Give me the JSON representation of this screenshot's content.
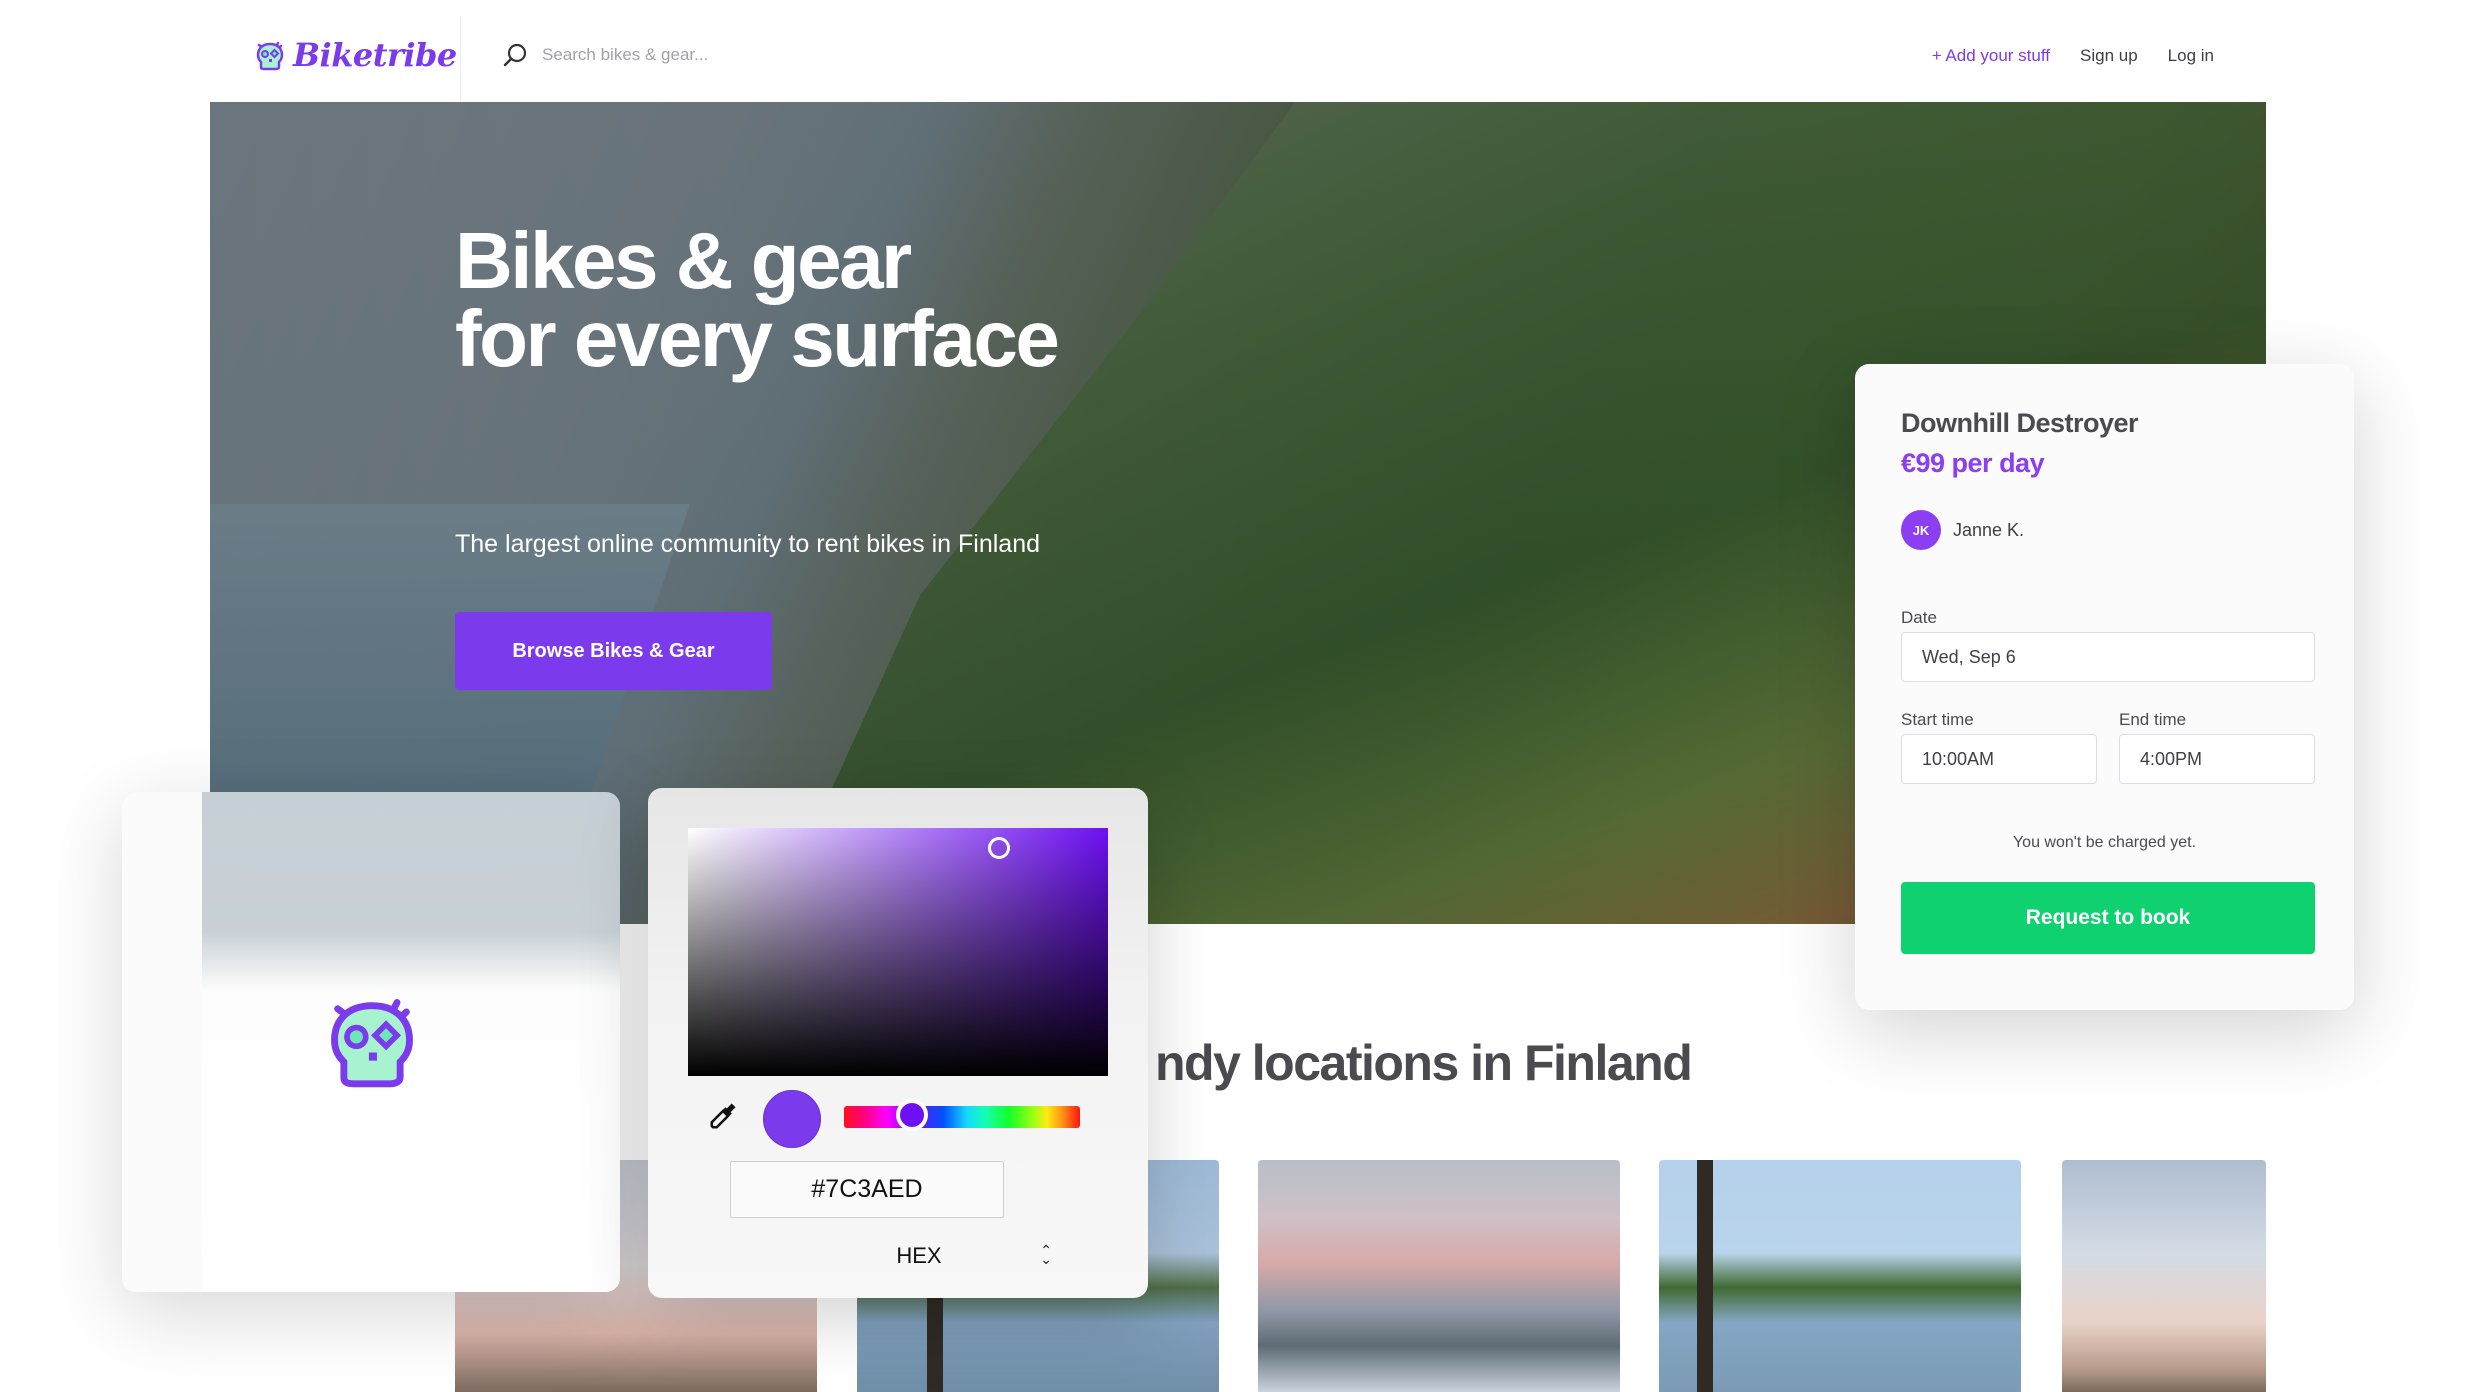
{
  "nav": {
    "brand": "Biketribe",
    "search_placeholder": "Search bikes & gear...",
    "links": [
      {
        "label": "+ Add your stuff",
        "accent": true
      },
      {
        "label": "Sign up",
        "accent": false
      },
      {
        "label": "Log in",
        "accent": false
      }
    ]
  },
  "hero": {
    "title_line1": "Bikes & gear",
    "title_line2": "for every surface",
    "subtitle": "The largest online community to rent bikes in Finland",
    "cta_label": "Browse Bikes & Gear"
  },
  "locations": {
    "title_visible": "ndy locations in Finland",
    "images": [
      "helsinki-cathedral-tram",
      "lake-pines",
      "sunset-lake-valley",
      "lake-tall-pines",
      "helsinki-cathedral-wires"
    ]
  },
  "color_picker": {
    "value": "#7C3AED",
    "format": "HEX",
    "eyedropper_icon": "eyedropper-icon",
    "swatch_color": "#7C3AED",
    "hue_color": "#6D10F2"
  },
  "booking": {
    "title": "Downhill Destroyer",
    "price": "€99 per day",
    "host_initials": "JK",
    "host_name": "Janne K.",
    "date_label": "Date",
    "date_value": "Wed, Sep 6",
    "start_label": "Start time",
    "start_value": "10:00AM",
    "end_label": "End time",
    "end_value": "4:00PM",
    "note": "You won't be charged yet.",
    "cta_label": "Request to book"
  },
  "colors": {
    "brand": "#7C3AED",
    "success": "#10D170",
    "text": "#3F3F46"
  }
}
